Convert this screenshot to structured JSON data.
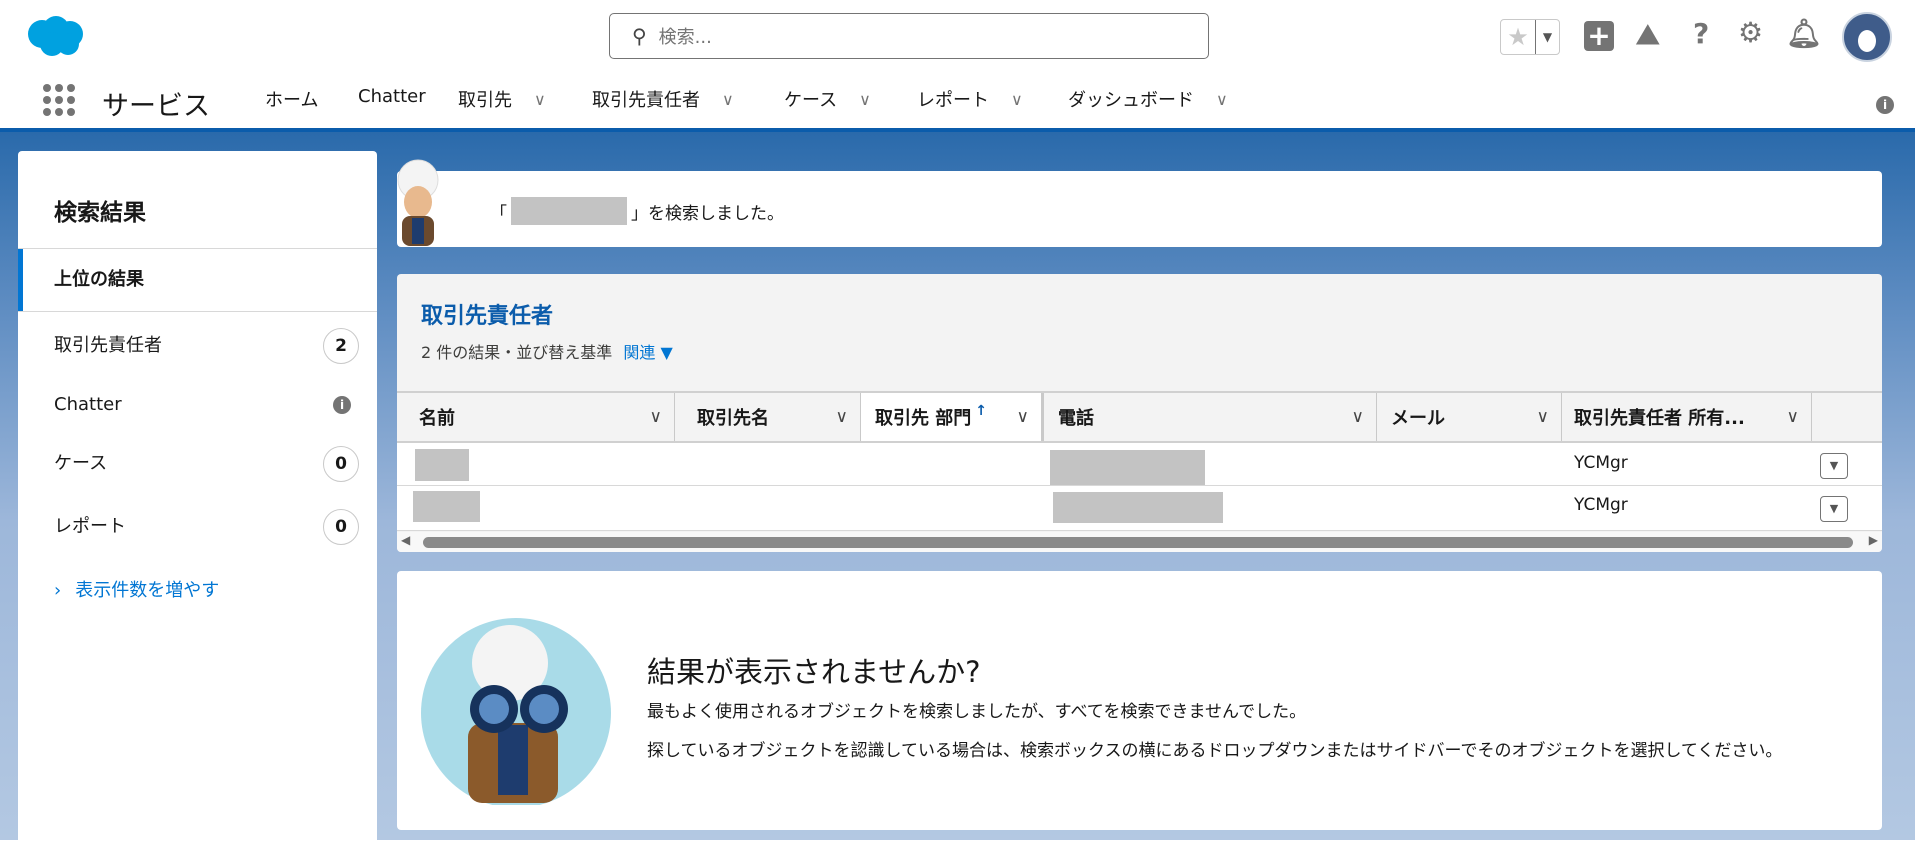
{
  "header": {
    "search_placeholder": "検索...",
    "app_name": "サービス",
    "nav": [
      {
        "label": "ホーム",
        "dropdown": false
      },
      {
        "label": "Chatter",
        "dropdown": false
      },
      {
        "label": "取引先",
        "dropdown": true
      },
      {
        "label": "取引先責任者",
        "dropdown": true
      },
      {
        "label": "ケース",
        "dropdown": true
      },
      {
        "label": "レポート",
        "dropdown": true
      },
      {
        "label": "ダッシュボード",
        "dropdown": true
      }
    ]
  },
  "sidebar": {
    "title": "検索結果",
    "items": [
      {
        "label": "上位の結果",
        "selected": true
      },
      {
        "label": "取引先責任者",
        "count": "2"
      },
      {
        "label": "Chatter",
        "info": true
      },
      {
        "label": "ケース",
        "count": "0"
      },
      {
        "label": "レポート",
        "count": "0"
      }
    ],
    "show_more": "表示件数を増やす"
  },
  "banner": {
    "prefix": "「",
    "suffix": "」を検索しました。"
  },
  "results": {
    "title": "取引先責任者",
    "summary": "2 件の結果・並び替え基準",
    "sort": "関連",
    "columns": [
      "名前",
      "取引先名",
      "取引先 部門",
      "電話",
      "メール",
      "取引先責任者 所有..."
    ],
    "rows": [
      {
        "owner": "YCMgr"
      },
      {
        "owner": "YCMgr"
      }
    ]
  },
  "empty": {
    "title": "結果が表示されませんか?",
    "line1": "最もよく使用されるオブジェクトを検索しましたが、すべてを検索できませんでした。",
    "line2": "探しているオブジェクトを認識している場合は、検索ボックスの横にあるドロップダウンまたはサイドバーでそのオブジェクトを選択してください。"
  },
  "colors": {
    "brand": "#0b5cab",
    "link": "#0176d3"
  }
}
